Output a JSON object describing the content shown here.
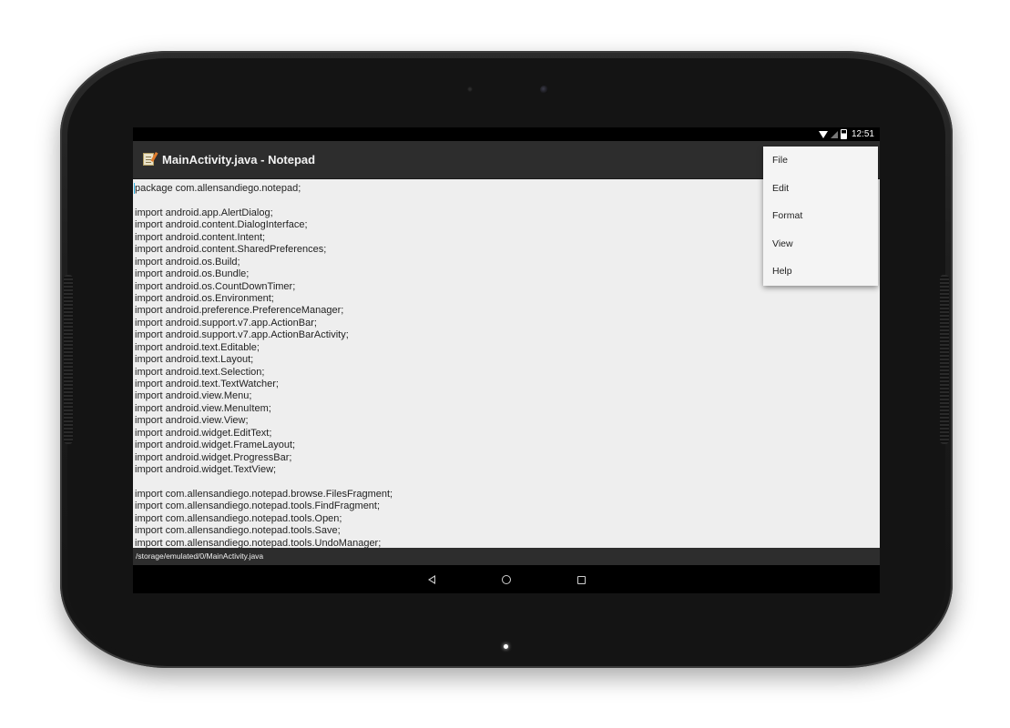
{
  "status_bar": {
    "time": "12:51",
    "icons": [
      "wifi-icon",
      "signal-icon",
      "battery-icon"
    ]
  },
  "action_bar": {
    "app_icon": "notepad-icon",
    "title": "MainActivity.java - Notepad"
  },
  "editor": {
    "lines": [
      "package com.allensandiego.notepad;",
      "",
      "import android.app.AlertDialog;",
      "import android.content.DialogInterface;",
      "import android.content.Intent;",
      "import android.content.SharedPreferences;",
      "import android.os.Build;",
      "import android.os.Bundle;",
      "import android.os.CountDownTimer;",
      "import android.os.Environment;",
      "import android.preference.PreferenceManager;",
      "import android.support.v7.app.ActionBar;",
      "import android.support.v7.app.ActionBarActivity;",
      "import android.text.Editable;",
      "import android.text.Layout;",
      "import android.text.Selection;",
      "import android.text.TextWatcher;",
      "import android.view.Menu;",
      "import android.view.MenuItem;",
      "import android.view.View;",
      "import android.widget.EditText;",
      "import android.widget.FrameLayout;",
      "import android.widget.ProgressBar;",
      "import android.widget.TextView;",
      "",
      "import com.allensandiego.notepad.browse.FilesFragment;",
      "import com.allensandiego.notepad.tools.FindFragment;",
      "import com.allensandiego.notepad.tools.Open;",
      "import com.allensandiego.notepad.tools.Save;",
      "import com.allensandiego.notepad.tools.UndoManager;"
    ]
  },
  "path_bar": {
    "path": "/storage/emulated/0/MainActivity.java"
  },
  "menu": {
    "items": [
      "File",
      "Edit",
      "Format",
      "View",
      "Help"
    ]
  },
  "nav_bar": {
    "icons": [
      "back-icon",
      "home-icon",
      "recents-icon"
    ]
  }
}
